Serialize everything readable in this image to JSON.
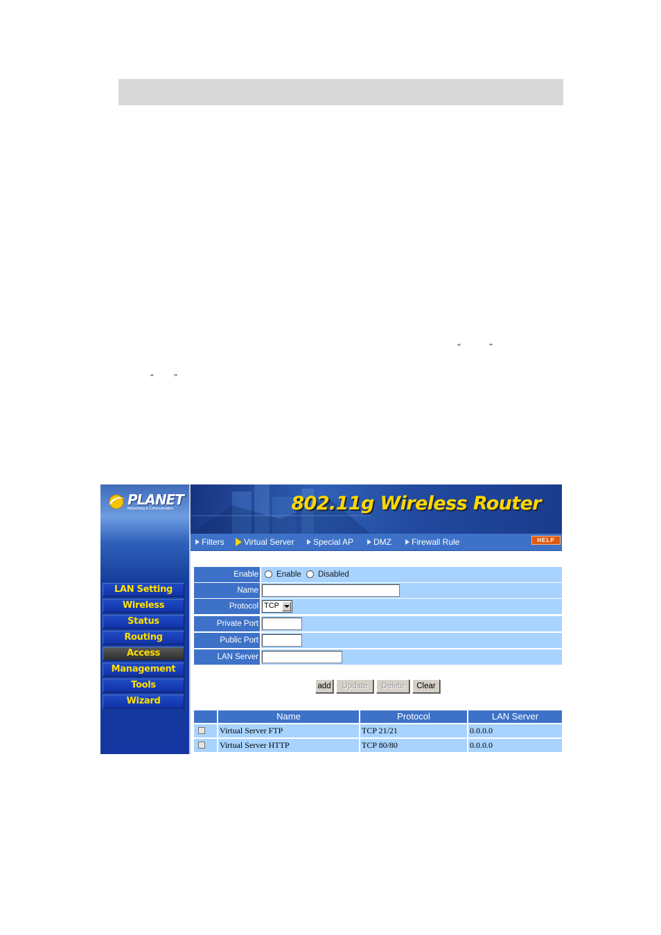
{
  "document": {
    "open_quote": "“",
    "close_quote": "”"
  },
  "brand": {
    "logo_name": "PLANET",
    "logo_tagline": "Networking & Communication",
    "product_title": "802.11g Wireless Router"
  },
  "colors": {
    "sidebar": "#1536a0",
    "nav_label": "#ffe000",
    "banner_title": "#ffd800",
    "label_bg": "#3e72c8",
    "value_bg": "#a8d3ff"
  },
  "tabs": [
    {
      "label": "Filters",
      "icon": "arrow-right-icon"
    },
    {
      "label": "Virtual Server",
      "icon": "arrow-right-icon",
      "selected": true
    },
    {
      "label": "Special AP",
      "icon": "arrow-right-icon"
    },
    {
      "label": "DMZ",
      "icon": "arrow-right-icon"
    },
    {
      "label": "Firewall Rule",
      "icon": "arrow-right-icon"
    }
  ],
  "help_label": "HELP",
  "sidebar": {
    "items": [
      {
        "label": "LAN Setting"
      },
      {
        "label": "Wireless"
      },
      {
        "label": "Status"
      },
      {
        "label": "Routing"
      },
      {
        "label": "Access",
        "active": true
      },
      {
        "label": "Management"
      },
      {
        "label": "Tools"
      },
      {
        "label": "Wizard"
      }
    ]
  },
  "form": {
    "enable_label": "Enable",
    "enable_option": "Enable",
    "disabled_option": "Disabled",
    "name_label": "Name",
    "name_value": "",
    "protocol_label": "Protocol",
    "protocol_value": "TCP",
    "private_port_label": "Private Port",
    "private_port_value": "",
    "public_port_label": "Public Port",
    "public_port_value": "",
    "lan_server_label": "LAN Server",
    "lan_server_value": ""
  },
  "buttons": {
    "add": "add",
    "update": "Update",
    "delete": "Delete",
    "clear": "Clear"
  },
  "table": {
    "headers": [
      "Name",
      "Protocol",
      "LAN Server"
    ],
    "rows": [
      {
        "name": "Virtual Server FTP",
        "protocol": "TCP 21/21",
        "lan_server": "0.0.0.0"
      },
      {
        "name": "Virtual Server HTTP",
        "protocol": "TCP 80/80",
        "lan_server": "0.0.0.0"
      }
    ]
  }
}
